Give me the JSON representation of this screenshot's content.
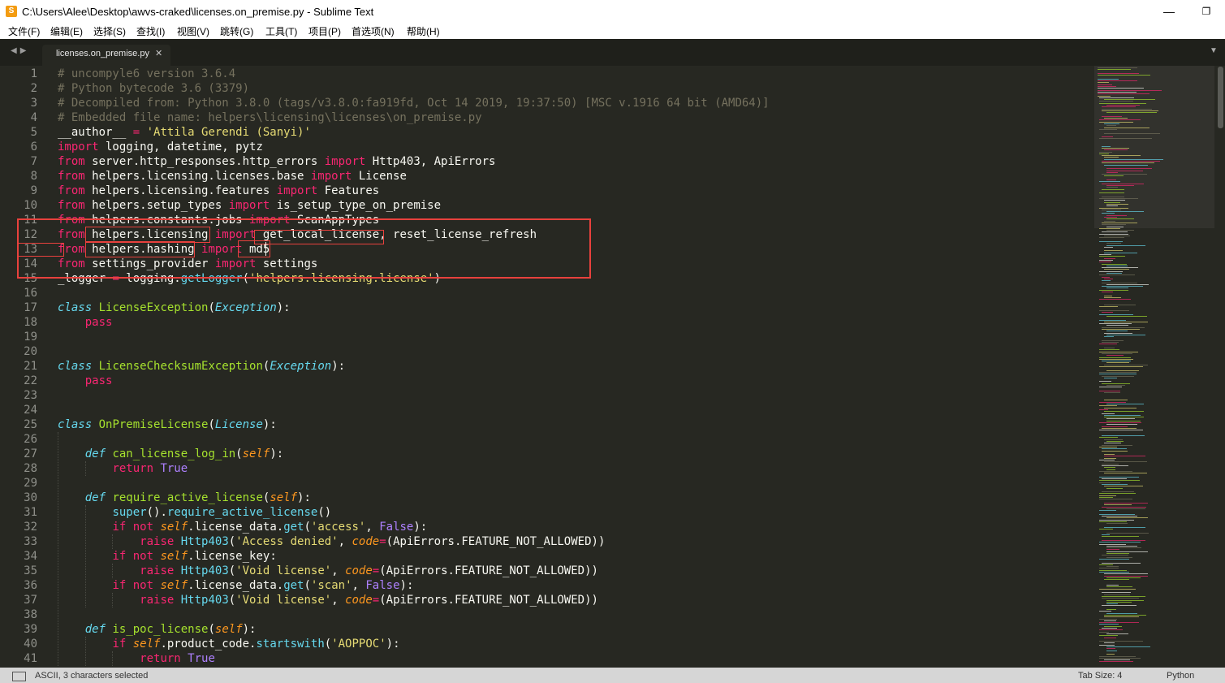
{
  "window": {
    "title": "C:\\Users\\Alee\\Desktop\\awvs-craked\\licenses.on_premise.py - Sublime Text",
    "minimize_glyph": "—",
    "maximize_glyph": "❐",
    "close_glyph": "✕",
    "app_icon_glyph": "S"
  },
  "menu": [
    "文件(F)",
    "编辑(E)",
    "选择(S)",
    "查找(I)",
    "视图(V)",
    "跳转(G)",
    "工具(T)",
    "项目(P)",
    "首选项(N)",
    "帮助(H)"
  ],
  "tabs": {
    "nav_arrows": "◀▶",
    "dropdown_glyph": "▼",
    "active_tab": {
      "label": "licenses.on_premise.py",
      "close_glyph": "✕"
    }
  },
  "editor": {
    "line_numbers": [
      "1",
      "2",
      "3",
      "4",
      "5",
      "6",
      "7",
      "8",
      "9",
      "10",
      "11",
      "12",
      "13",
      "14",
      "15",
      "16",
      "17",
      "18",
      "19",
      "20",
      "21",
      "22",
      "23",
      "24",
      "25",
      "26",
      "27",
      "28",
      "29",
      "30",
      "31",
      "32",
      "33",
      "34",
      "35",
      "36",
      "37",
      "38",
      "39",
      "40",
      "41"
    ],
    "lines": [
      [
        [
          "cm",
          "# uncompyle6 version 3.6.4"
        ]
      ],
      [
        [
          "cm",
          "# Python bytecode 3.6 (3379)"
        ]
      ],
      [
        [
          "cm",
          "# Decompiled from: Python 3.8.0 (tags/v3.8.0:fa919fd, Oct 14 2019, 19:37:50) [MSC v.1916 64 bit (AMD64)]"
        ]
      ],
      [
        [
          "cm",
          "# Embedded file name: helpers\\licensing\\licenses\\on_premise.py"
        ]
      ],
      [
        [
          "",
          "__author__ "
        ],
        [
          "kw",
          "="
        ],
        [
          "st",
          " 'Attila Gerendi (Sanyi)'"
        ]
      ],
      [
        [
          "kw",
          "import"
        ],
        [
          "",
          " logging, datetime, pytz"
        ]
      ],
      [
        [
          "kw",
          "from"
        ],
        [
          "",
          " server.http_responses.http_errors "
        ],
        [
          "kw",
          "import"
        ],
        [
          "",
          " Http403, ApiErrors"
        ]
      ],
      [
        [
          "kw",
          "from"
        ],
        [
          "",
          " helpers.licensing.licenses.base "
        ],
        [
          "kw",
          "import"
        ],
        [
          "",
          " License"
        ]
      ],
      [
        [
          "kw",
          "from"
        ],
        [
          "",
          " helpers.licensing.features "
        ],
        [
          "kw",
          "import"
        ],
        [
          "",
          " Features"
        ]
      ],
      [
        [
          "kw",
          "from"
        ],
        [
          "",
          " helpers.setup_types "
        ],
        [
          "kw",
          "import"
        ],
        [
          "",
          " is_setup_type_on_premise"
        ]
      ],
      [
        [
          "kw",
          "from"
        ],
        [
          "",
          " helpers.constants.jobs "
        ],
        [
          "kw",
          "import"
        ],
        [
          "",
          " ScanAppTypes"
        ]
      ],
      [
        [
          "kw",
          "from"
        ],
        [
          "",
          " helpers.licensing "
        ],
        [
          "kw",
          "import"
        ],
        [
          "",
          " get_local_license, reset_license_refresh"
        ]
      ],
      [
        [
          "kw",
          "from"
        ],
        [
          "",
          " helpers.hashing "
        ],
        [
          "kw",
          "import"
        ],
        [
          "",
          " md5"
        ]
      ],
      [
        [
          "kw",
          "from"
        ],
        [
          "",
          " settings_provider "
        ],
        [
          "kw",
          "import"
        ],
        [
          "",
          " settings"
        ]
      ],
      [
        [
          "",
          "_logger "
        ],
        [
          "kw",
          "="
        ],
        [
          "",
          " logging."
        ],
        [
          "bt",
          "getLogger"
        ],
        [
          "",
          "("
        ],
        [
          "st",
          "'helpers.licensing.license'"
        ],
        [
          "",
          ")"
        ]
      ],
      [],
      [
        [
          "it",
          "class"
        ],
        [
          "",
          " "
        ],
        [
          "fn",
          "LicenseException"
        ],
        [
          "",
          "("
        ],
        [
          "it",
          "Exception"
        ],
        [
          "",
          "):"
        ]
      ],
      [
        [
          "",
          "    "
        ],
        [
          "kw",
          "pass"
        ]
      ],
      [],
      [],
      [
        [
          "it",
          "class"
        ],
        [
          "",
          " "
        ],
        [
          "fn",
          "LicenseChecksumException"
        ],
        [
          "",
          "("
        ],
        [
          "it",
          "Exception"
        ],
        [
          "",
          "):"
        ]
      ],
      [
        [
          "",
          "    "
        ],
        [
          "kw",
          "pass"
        ]
      ],
      [],
      [],
      [
        [
          "it",
          "class"
        ],
        [
          "",
          " "
        ],
        [
          "fn",
          "OnPremiseLicense"
        ],
        [
          "",
          "("
        ],
        [
          "it",
          "License"
        ],
        [
          "",
          "):"
        ]
      ],
      [],
      [
        [
          "",
          "    "
        ],
        [
          "it",
          "def"
        ],
        [
          "",
          " "
        ],
        [
          "fn",
          "can_license_log_in"
        ],
        [
          "",
          "("
        ],
        [
          "pr",
          "self"
        ],
        [
          "",
          "):"
        ]
      ],
      [
        [
          "",
          "        "
        ],
        [
          "kw",
          "return"
        ],
        [
          "",
          " "
        ],
        [
          "cn",
          "True"
        ]
      ],
      [],
      [
        [
          "",
          "    "
        ],
        [
          "it",
          "def"
        ],
        [
          "",
          " "
        ],
        [
          "fn",
          "require_active_license"
        ],
        [
          "",
          "("
        ],
        [
          "pr",
          "self"
        ],
        [
          "",
          "):"
        ]
      ],
      [
        [
          "",
          "        "
        ],
        [
          "bt",
          "super"
        ],
        [
          "",
          "()."
        ],
        [
          "bt",
          "require_active_license"
        ],
        [
          "",
          "()"
        ]
      ],
      [
        [
          "",
          "        "
        ],
        [
          "kw",
          "if not"
        ],
        [
          "",
          " "
        ],
        [
          "pr",
          "self"
        ],
        [
          "",
          ".license_data."
        ],
        [
          "bt",
          "get"
        ],
        [
          "",
          "("
        ],
        [
          "st",
          "'access'"
        ],
        [
          "",
          ", "
        ],
        [
          "cn",
          "False"
        ],
        [
          "",
          "):"
        ]
      ],
      [
        [
          "",
          "            "
        ],
        [
          "kw",
          "raise"
        ],
        [
          "",
          " "
        ],
        [
          "bt",
          "Http403"
        ],
        [
          "",
          "("
        ],
        [
          "st",
          "'Access denied'"
        ],
        [
          "",
          ", "
        ],
        [
          "pr",
          "code"
        ],
        [
          "kw",
          "="
        ],
        [
          "",
          "(ApiErrors.FEATURE_NOT_ALLOWED))"
        ]
      ],
      [
        [
          "",
          "        "
        ],
        [
          "kw",
          "if not"
        ],
        [
          "",
          " "
        ],
        [
          "pr",
          "self"
        ],
        [
          "",
          ".license_key:"
        ]
      ],
      [
        [
          "",
          "            "
        ],
        [
          "kw",
          "raise"
        ],
        [
          "",
          " "
        ],
        [
          "bt",
          "Http403"
        ],
        [
          "",
          "("
        ],
        [
          "st",
          "'Void license'"
        ],
        [
          "",
          ", "
        ],
        [
          "pr",
          "code"
        ],
        [
          "kw",
          "="
        ],
        [
          "",
          "(ApiErrors.FEATURE_NOT_ALLOWED))"
        ]
      ],
      [
        [
          "",
          "        "
        ],
        [
          "kw",
          "if not"
        ],
        [
          "",
          " "
        ],
        [
          "pr",
          "self"
        ],
        [
          "",
          ".license_data."
        ],
        [
          "bt",
          "get"
        ],
        [
          "",
          "("
        ],
        [
          "st",
          "'scan'"
        ],
        [
          "",
          ", "
        ],
        [
          "cn",
          "False"
        ],
        [
          "",
          "):"
        ]
      ],
      [
        [
          "",
          "            "
        ],
        [
          "kw",
          "raise"
        ],
        [
          "",
          " "
        ],
        [
          "bt",
          "Http403"
        ],
        [
          "",
          "("
        ],
        [
          "st",
          "'Void license'"
        ],
        [
          "",
          ", "
        ],
        [
          "pr",
          "code"
        ],
        [
          "kw",
          "="
        ],
        [
          "",
          "(ApiErrors.FEATURE_NOT_ALLOWED))"
        ]
      ],
      [],
      [
        [
          "",
          "    "
        ],
        [
          "it",
          "def"
        ],
        [
          "",
          " "
        ],
        [
          "fn",
          "is_poc_license"
        ],
        [
          "",
          "("
        ],
        [
          "pr",
          "self"
        ],
        [
          "",
          "):"
        ]
      ],
      [
        [
          "",
          "        "
        ],
        [
          "kw",
          "if"
        ],
        [
          "",
          " "
        ],
        [
          "pr",
          "self"
        ],
        [
          "",
          ".product_code."
        ],
        [
          "bt",
          "startswith"
        ],
        [
          "",
          "("
        ],
        [
          "st",
          "'AOPPOC'"
        ],
        [
          "",
          "):"
        ]
      ],
      [
        [
          "",
          "            "
        ],
        [
          "kw",
          "return"
        ],
        [
          "",
          " "
        ],
        [
          "cn",
          "True"
        ]
      ]
    ]
  },
  "colors": {
    "background": "#272822",
    "comment": "#75715e",
    "keyword": "#f92672",
    "string": "#e6db74",
    "function": "#a6e22e",
    "builtin": "#66d9ef",
    "constant": "#ae81ff",
    "parameter": "#fd971f",
    "annotation_box": "#e8413d"
  },
  "status": {
    "selection": "ASCII, 3 characters selected",
    "tab_size": "Tab Size: 4",
    "syntax": "Python"
  }
}
